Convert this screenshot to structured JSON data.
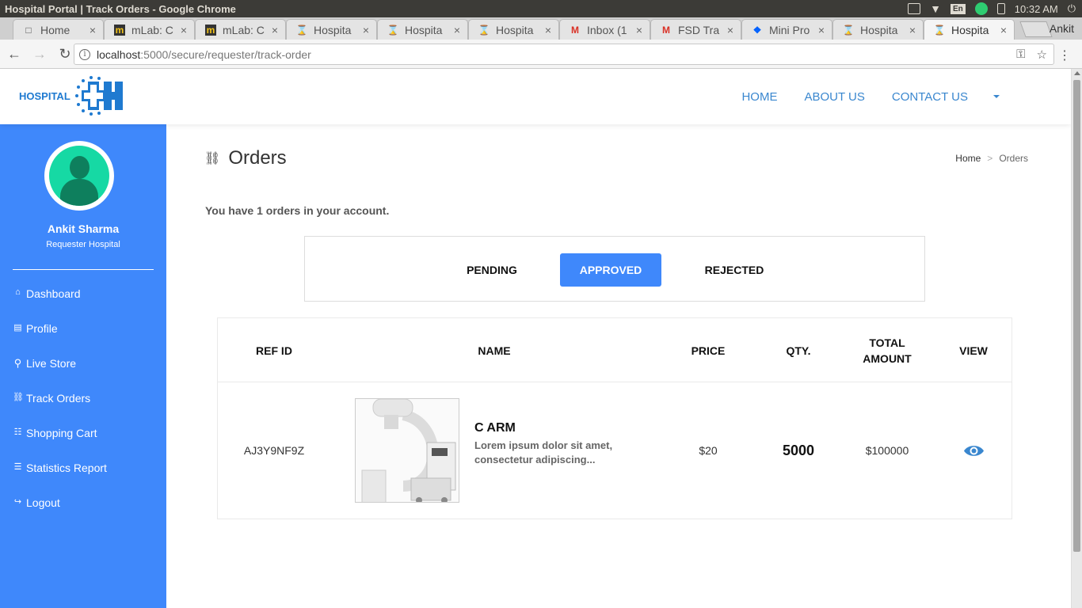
{
  "os": {
    "window_title": "Hospital Portal | Track Orders - Google Chrome",
    "keyboard": "En",
    "clock": "10:32 AM"
  },
  "browser": {
    "tabs": [
      {
        "title": "Home",
        "icon": "document-icon"
      },
      {
        "title": "mLab: C",
        "icon": "mlab-icon"
      },
      {
        "title": "mLab: C",
        "icon": "mlab-icon"
      },
      {
        "title": "Hospita",
        "icon": "hospital-icon"
      },
      {
        "title": "Hospita",
        "icon": "hospital-icon"
      },
      {
        "title": "Hospita",
        "icon": "hospital-icon"
      },
      {
        "title": "Inbox (1",
        "icon": "gmail-icon"
      },
      {
        "title": "FSD Tra",
        "icon": "gmail-icon"
      },
      {
        "title": "Mini Pro",
        "icon": "dropbox-icon"
      },
      {
        "title": "Hospita",
        "icon": "hospital-icon"
      },
      {
        "title": "Hospita",
        "icon": "hospital-icon"
      }
    ],
    "profile_name": "Ankit",
    "url_host": "localhost",
    "url_path": ":5000/secure/requester/track-order"
  },
  "header": {
    "logo_text": "HOSPITAL",
    "nav": [
      "HOME",
      "ABOUT US",
      "CONTACT US"
    ]
  },
  "sidebar": {
    "user_name": "Ankit Sharma",
    "user_role": "Requester Hospital",
    "menu": [
      {
        "label": "Dashboard",
        "icon": "home-icon"
      },
      {
        "label": "Profile",
        "icon": "id-card-icon"
      },
      {
        "label": "Live Store",
        "icon": "search-icon"
      },
      {
        "label": "Track Orders",
        "icon": "forklift-icon"
      },
      {
        "label": "Shopping Cart",
        "icon": "cart-icon"
      },
      {
        "label": "Statistics Report",
        "icon": "report-icon"
      },
      {
        "label": "Logout",
        "icon": "logout-icon"
      }
    ]
  },
  "main": {
    "title": "Orders",
    "breadcrumb": {
      "home": "Home",
      "separator": ">",
      "current": "Orders"
    },
    "count_message": "You have 1 orders in your account.",
    "filters": {
      "pending": "PENDING",
      "approved": "APPROVED",
      "rejected": "REJECTED",
      "active": "APPROVED"
    },
    "table": {
      "headers": {
        "ref_id": "REF ID",
        "name": "NAME",
        "price": "PRICE",
        "qty": "QTY.",
        "total_line1": "TOTAL",
        "total_line2": "AMOUNT",
        "view": "VIEW"
      },
      "rows": [
        {
          "ref_id": "AJ3Y9NF9Z",
          "product_name": "C ARM",
          "description_line1": "Lorem ipsum dolor sit amet,",
          "description_line2": "consectetur adipiscing...",
          "price": "$20",
          "qty": "5000",
          "total": "$100000"
        }
      ]
    }
  },
  "colors": {
    "sidebar": "#3f88fb",
    "accent": "#3a87cf",
    "avatar": "#16d9a4"
  }
}
